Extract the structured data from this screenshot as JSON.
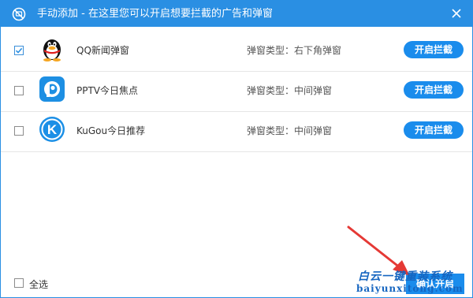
{
  "window": {
    "title": "手动添加 - 在这里您可以开启想要拦截的广告和弹窗"
  },
  "rows": [
    {
      "checked": true,
      "icon": "qq-penguin-icon",
      "app_name": "QQ新闻弹窗",
      "popup_type": "弹窗类型：右下角弹窗",
      "button": "开启拦截"
    },
    {
      "checked": false,
      "icon": "pptv-icon",
      "app_name": "PPTV今日焦点",
      "popup_type": "弹窗类型：中间弹窗",
      "button": "开启拦截"
    },
    {
      "checked": false,
      "icon": "kugou-icon",
      "app_name": "KuGou今日推荐",
      "popup_type": "弹窗类型：中间弹窗",
      "button": "开启拦截"
    }
  ],
  "footer": {
    "select_all": "全选",
    "confirm": "确认开启"
  },
  "watermark": {
    "line1": "白云一键重装系统",
    "line2": "baiyunxitong.com"
  },
  "colors": {
    "accent": "#2a8fe3",
    "button": "#1a8cec",
    "annotation_arrow": "#e53935"
  }
}
